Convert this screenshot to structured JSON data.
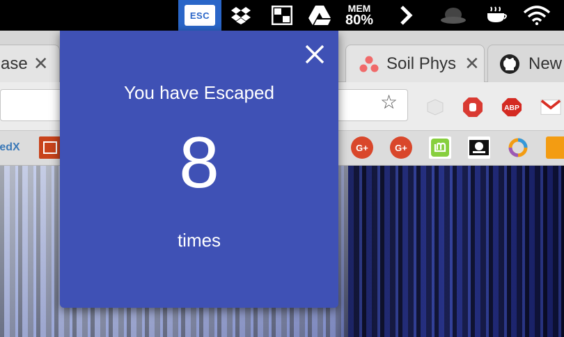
{
  "menubar": {
    "esc_label": "ESC",
    "mem_label": "MEM",
    "mem_value": "80%",
    "icons": [
      "esc-extension-icon",
      "dropbox-icon",
      "window-switch-icon",
      "google-drive-icon",
      "memory-monitor-icon",
      "chevron-right-icon",
      "hat-icon",
      "coffee-cup-icon",
      "wifi-icon"
    ]
  },
  "tabs": [
    {
      "title": "ase",
      "close": "✕"
    },
    {
      "title": "Soil Phys",
      "close": "✕"
    },
    {
      "title": "New",
      "close": ""
    }
  ],
  "toolbar": {
    "star": "☆",
    "extensions": [
      "cube-extension-icon",
      "stop-hand-extension-icon",
      "adblock-plus-icon",
      "gmail-icon"
    ],
    "abp_label": "ABP"
  },
  "bookmarks": {
    "left_label": "edX",
    "gplus_label": "G+"
  },
  "popup": {
    "heading": "You have Escaped",
    "count": "8",
    "unit": "times",
    "accent": "#3f51b5"
  }
}
